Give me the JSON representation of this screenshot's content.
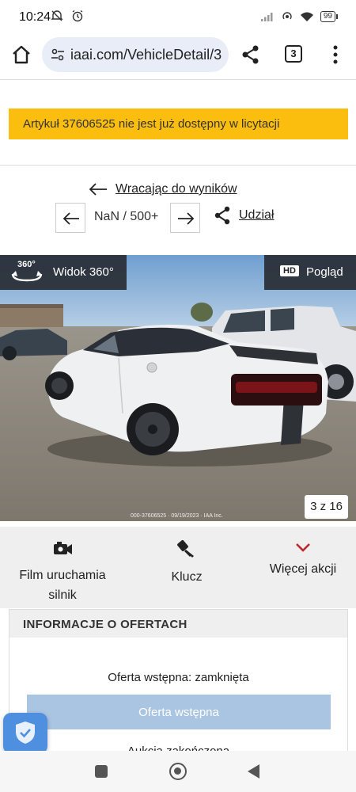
{
  "status_bar": {
    "time": "10:24",
    "battery": "99",
    "left_icons": [
      "do-not-disturb-icon",
      "alarm-icon"
    ],
    "right_icons": [
      "signal-icon",
      "hotspot-icon",
      "wifi-icon",
      "battery-icon"
    ]
  },
  "browser": {
    "url": "iaai.com/VehicleDetail/3",
    "tab_count": "3"
  },
  "notice": {
    "text": "Artykuł 37606525 nie jest już dostępny w licytacji",
    "color": "#fbbd0e"
  },
  "navigation": {
    "back_label": "Wracając do wyników",
    "pager_count": "NaN / 500+",
    "share_label": "Udział"
  },
  "gallery": {
    "view360_label": "Widok 360°",
    "view360_badge": "360°",
    "hd_badge": "HD",
    "preview_label": "Pogląd",
    "counter": "3 z 16",
    "stamp": "000-37606525 · 09/19/2023 · IAA Inc."
  },
  "actions": [
    {
      "label": "Film uruchamia silnik",
      "icon": "engine-video-icon"
    },
    {
      "label": "Klucz",
      "icon": "key-icon"
    },
    {
      "label": "Więcej akcji",
      "icon": "chevron-down-icon"
    }
  ],
  "offers": {
    "title": "INFORMACJE O OFERTACH",
    "status": "Oferta wstępna: zamknięta",
    "button_label": "Oferta wstępna",
    "auction_status": "Aukcja zakończona"
  },
  "colors": {
    "notice": "#fbbd0e",
    "offer_button": "#a9c5e2",
    "accent_red": "#c0272d"
  }
}
